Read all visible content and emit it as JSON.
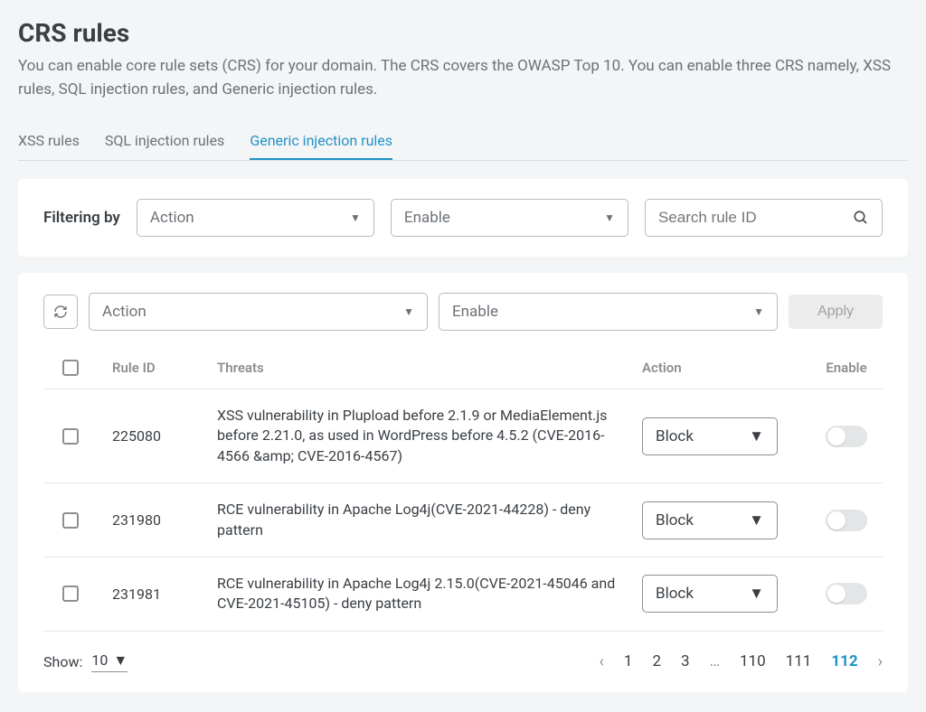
{
  "header": {
    "title": "CRS rules",
    "subtitle": "You can enable core rule sets (CRS) for your domain. The CRS covers the OWASP Top 10. You can enable three CRS namely, XSS rules, SQL injection rules, and Generic injection rules."
  },
  "tabs": [
    {
      "label": "XSS rules",
      "active": false
    },
    {
      "label": "SQL injection rules",
      "active": false
    },
    {
      "label": "Generic injection rules",
      "active": true
    }
  ],
  "filter": {
    "label": "Filtering by",
    "action": "Action",
    "enable": "Enable",
    "search_placeholder": "Search rule ID"
  },
  "toolbar": {
    "action": "Action",
    "enable": "Enable",
    "apply_label": "Apply"
  },
  "table": {
    "headers": {
      "rule_id": "Rule ID",
      "threats": "Threats",
      "action": "Action",
      "enable": "Enable"
    },
    "rows": [
      {
        "id": "225080",
        "threat": "XSS vulnerability in Plupload before 2.1.9 or MediaElement.js before 2.21.0, as used in WordPress before 4.5.2 (CVE-2016-4566 &amp; CVE-2016-4567)",
        "action": "Block",
        "enabled": false
      },
      {
        "id": "231980",
        "threat": "RCE vulnerability in Apache Log4j(CVE-2021-44228) - deny pattern",
        "action": "Block",
        "enabled": false
      },
      {
        "id": "231981",
        "threat": "RCE vulnerability in Apache Log4j 2.15.0(CVE-2021-45046 and CVE-2021-45105) - deny pattern",
        "action": "Block",
        "enabled": false
      }
    ]
  },
  "pagination": {
    "show_label": "Show:",
    "show_value": "10",
    "pages_left": [
      "1",
      "2",
      "3"
    ],
    "ellipsis": "…",
    "pages_right": [
      "110",
      "111"
    ],
    "current": "112"
  }
}
